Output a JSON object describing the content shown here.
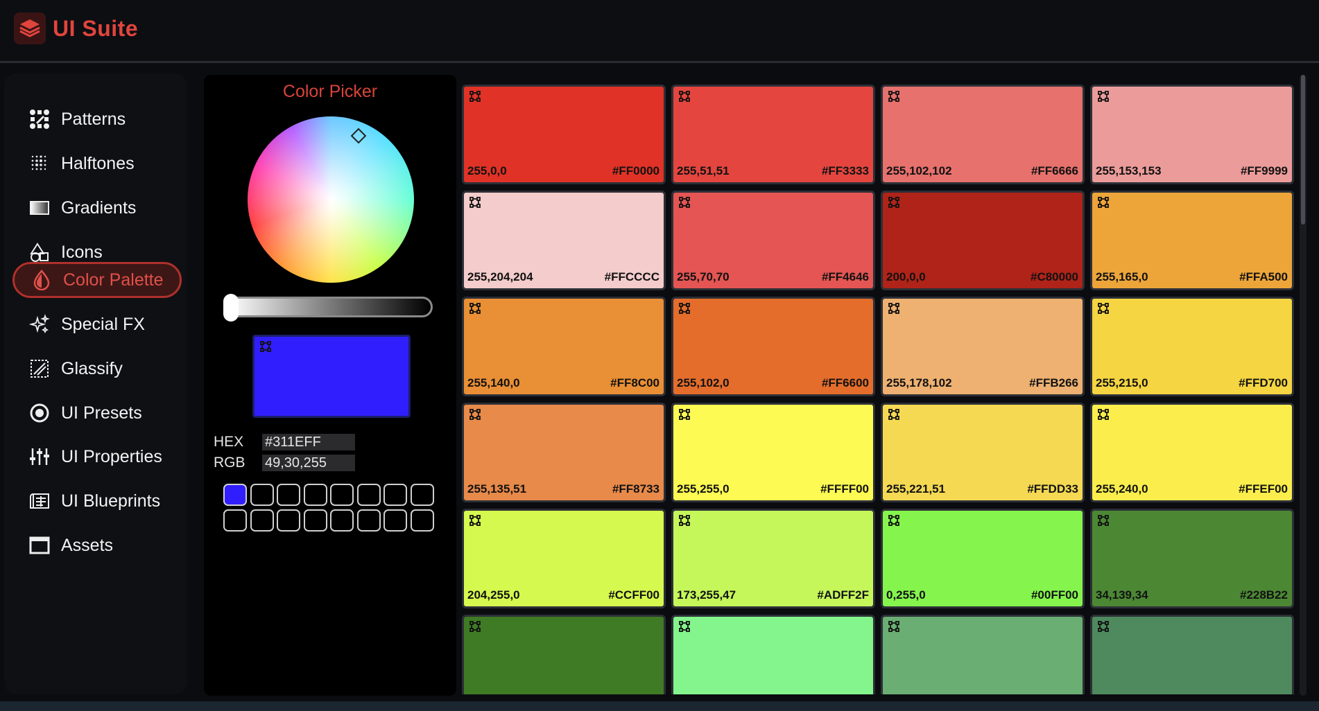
{
  "app": {
    "title": "UI Suite"
  },
  "sidebar": {
    "items": [
      {
        "label": "Patterns",
        "icon": "patterns-icon"
      },
      {
        "label": "Halftones",
        "icon": "halftones-icon"
      },
      {
        "label": "Gradients",
        "icon": "gradients-icon"
      },
      {
        "label": "Icons",
        "icon": "shapes-icon"
      },
      {
        "label": "Color Palette",
        "icon": "droplet-icon",
        "active": true
      },
      {
        "label": "Special FX",
        "icon": "sparkles-icon"
      },
      {
        "label": "Glassify",
        "icon": "glass-icon"
      },
      {
        "label": "UI Presets",
        "icon": "radio-icon"
      },
      {
        "label": "UI Properties",
        "icon": "sliders-icon"
      },
      {
        "label": "UI Blueprints",
        "icon": "blueprint-icon"
      },
      {
        "label": "Assets",
        "icon": "window-icon"
      }
    ]
  },
  "picker": {
    "title": "Color Picker",
    "hex_label": "HEX",
    "hex_value": "#311EFF",
    "rgb_label": "RGB",
    "rgb_value": "49,30,255",
    "current_color": "#311EFF",
    "brightness": 0.0
  },
  "palette": [
    {
      "rgb": "255,0,0",
      "hex": "#FF0000",
      "fill": "#e03226"
    },
    {
      "rgb": "255,51,51",
      "hex": "#FF3333",
      "fill": "#e4463f"
    },
    {
      "rgb": "255,102,102",
      "hex": "#FF6666",
      "fill": "#e6716d"
    },
    {
      "rgb": "255,153,153",
      "hex": "#FF9999",
      "fill": "#eb9c9a"
    },
    {
      "rgb": "255,204,204",
      "hex": "#FFCCCC",
      "fill": "#f3cccb"
    },
    {
      "rgb": "255,70,70",
      "hex": "#FF4646",
      "fill": "#e45553"
    },
    {
      "rgb": "200,0,0",
      "hex": "#C80000",
      "fill": "#b02318"
    },
    {
      "rgb": "255,165,0",
      "hex": "#FFA500",
      "fill": "#eda53a"
    },
    {
      "rgb": "255,140,0",
      "hex": "#FF8C00",
      "fill": "#e98f35"
    },
    {
      "rgb": "255,102,0",
      "hex": "#FF6600",
      "fill": "#e46d2b"
    },
    {
      "rgb": "255,178,102",
      "hex": "#FFB266",
      "fill": "#eeb171"
    },
    {
      "rgb": "255,215,0",
      "hex": "#FFD700",
      "fill": "#f5d541"
    },
    {
      "rgb": "255,135,51",
      "hex": "#FF8733",
      "fill": "#e88a4a"
    },
    {
      "rgb": "255,255,0",
      "hex": "#FFFF00",
      "fill": "#fdfb53"
    },
    {
      "rgb": "255,221,51",
      "hex": "#FFDD33",
      "fill": "#f5d953"
    },
    {
      "rgb": "255,240,0",
      "hex": "#FFEF00",
      "fill": "#fbee4c"
    },
    {
      "rgb": "204,255,0",
      "hex": "#CCFF00",
      "fill": "#d6f94f"
    },
    {
      "rgb": "173,255,47",
      "hex": "#ADFF2F",
      "fill": "#c5f75a"
    },
    {
      "rgb": "0,255,0",
      "hex": "#00FF00",
      "fill": "#85f54d"
    },
    {
      "rgb": "34,139,34",
      "hex": "#228B22",
      "fill": "#4c8834"
    },
    {
      "rgb": "",
      "hex": "",
      "fill": "#3f7b25"
    },
    {
      "rgb": "",
      "hex": "",
      "fill": "#84f58c"
    },
    {
      "rgb": "",
      "hex": "",
      "fill": "#6aae73"
    },
    {
      "rgb": "",
      "hex": "",
      "fill": "#4e8a5e"
    }
  ],
  "colors": {
    "accent": "#e0453d",
    "background": "#0b0c10"
  }
}
